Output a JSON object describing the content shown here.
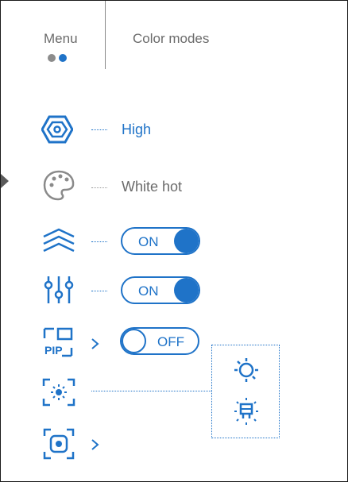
{
  "header": {
    "menu_label": "Menu",
    "title": "Color modes",
    "page_dots": [
      "inactive",
      "active"
    ]
  },
  "rows": [
    {
      "icon": "hexagon-eye-icon",
      "value": "High",
      "control": "text"
    },
    {
      "icon": "palette-icon",
      "value": "White hot",
      "control": "text"
    },
    {
      "icon": "waves-icon",
      "control": "toggle",
      "toggle_label": "ON",
      "toggle_state": "on"
    },
    {
      "icon": "sliders-icon",
      "control": "toggle",
      "toggle_label": "ON",
      "toggle_state": "on"
    },
    {
      "icon": "pip-icon",
      "control": "toggle",
      "toggle_label": "OFF",
      "toggle_state": "off",
      "chevron": true
    },
    {
      "icon": "brightness-frame-icon",
      "control": "popup"
    },
    {
      "icon": "target-frame-icon",
      "control": "none",
      "chevron": true
    }
  ],
  "popup": {
    "items": [
      "brightness-icon",
      "display-brightness-icon"
    ]
  },
  "colors": {
    "accent": "#1f73c8",
    "text_gray": "#6b6b6b",
    "dot_inactive": "#8c8c8c"
  }
}
